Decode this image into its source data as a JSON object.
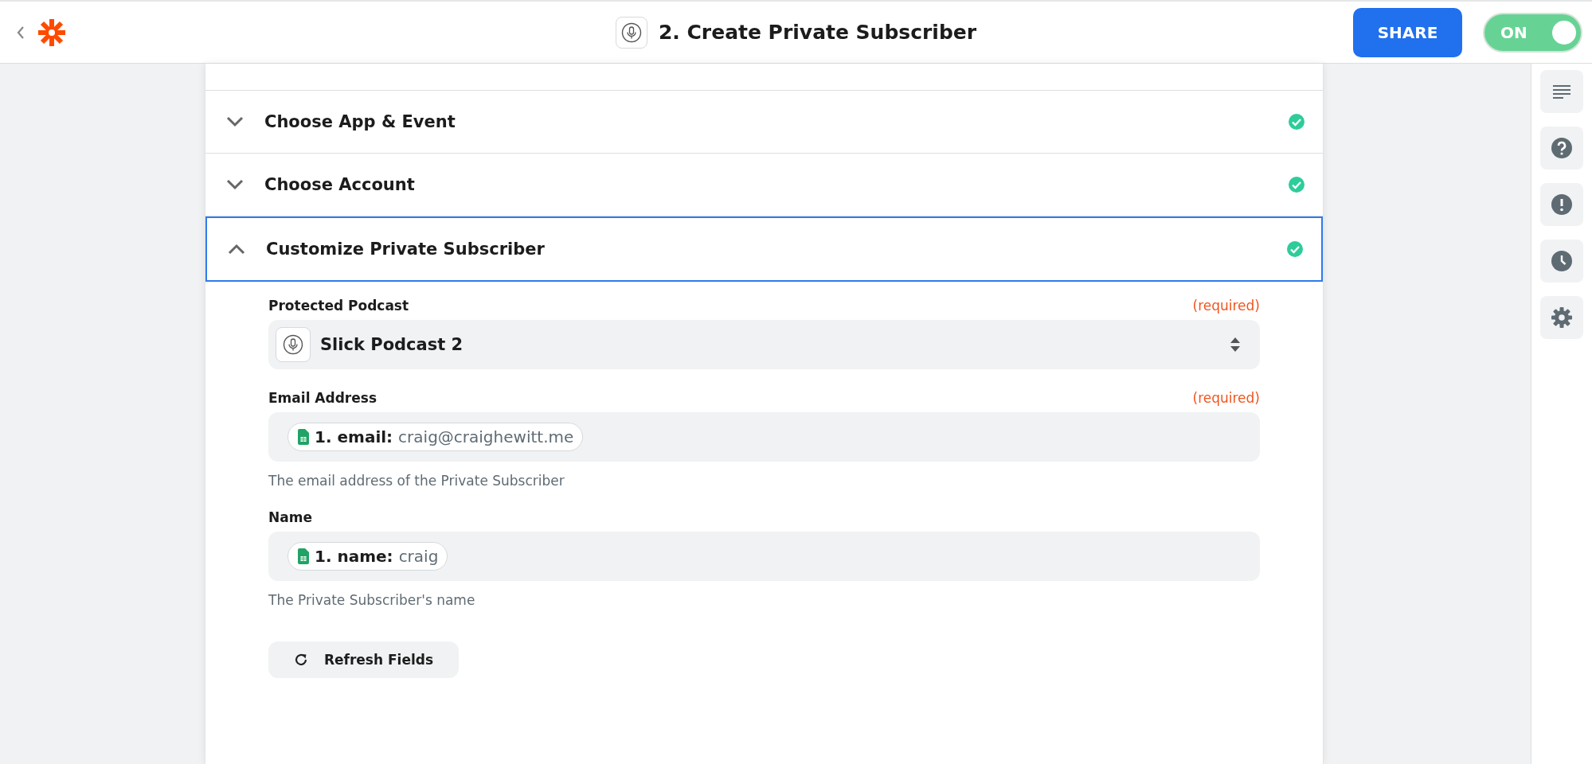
{
  "header": {
    "title": "2. Create Private Subscriber",
    "share_button": "SHARE",
    "toggle": {
      "label": "ON",
      "on": true
    }
  },
  "sections": [
    {
      "title": "Choose App & Event",
      "expanded": false,
      "complete": true
    },
    {
      "title": "Choose Account",
      "expanded": false,
      "complete": true
    },
    {
      "title": "Customize Private Subscriber",
      "expanded": true,
      "complete": true
    }
  ],
  "fields": [
    {
      "kind": "select",
      "label": "Protected Podcast",
      "required": "(required)",
      "value": "Slick Podcast 2"
    },
    {
      "kind": "token",
      "label": "Email Address",
      "required": "(required)",
      "token_label": "1. email:",
      "token_value": "craig@craighewitt.me",
      "help": "The email address of the Private Subscriber"
    },
    {
      "kind": "token",
      "label": "Name",
      "token_label": "1. name:",
      "token_value": "craig",
      "help": "The Private Subscriber's name"
    }
  ],
  "refresh_button": "Refresh Fields",
  "sidebar": [
    {
      "kind": "details"
    },
    {
      "kind": "help"
    },
    {
      "kind": "alert"
    },
    {
      "kind": "history"
    },
    {
      "kind": "settings"
    }
  ]
}
